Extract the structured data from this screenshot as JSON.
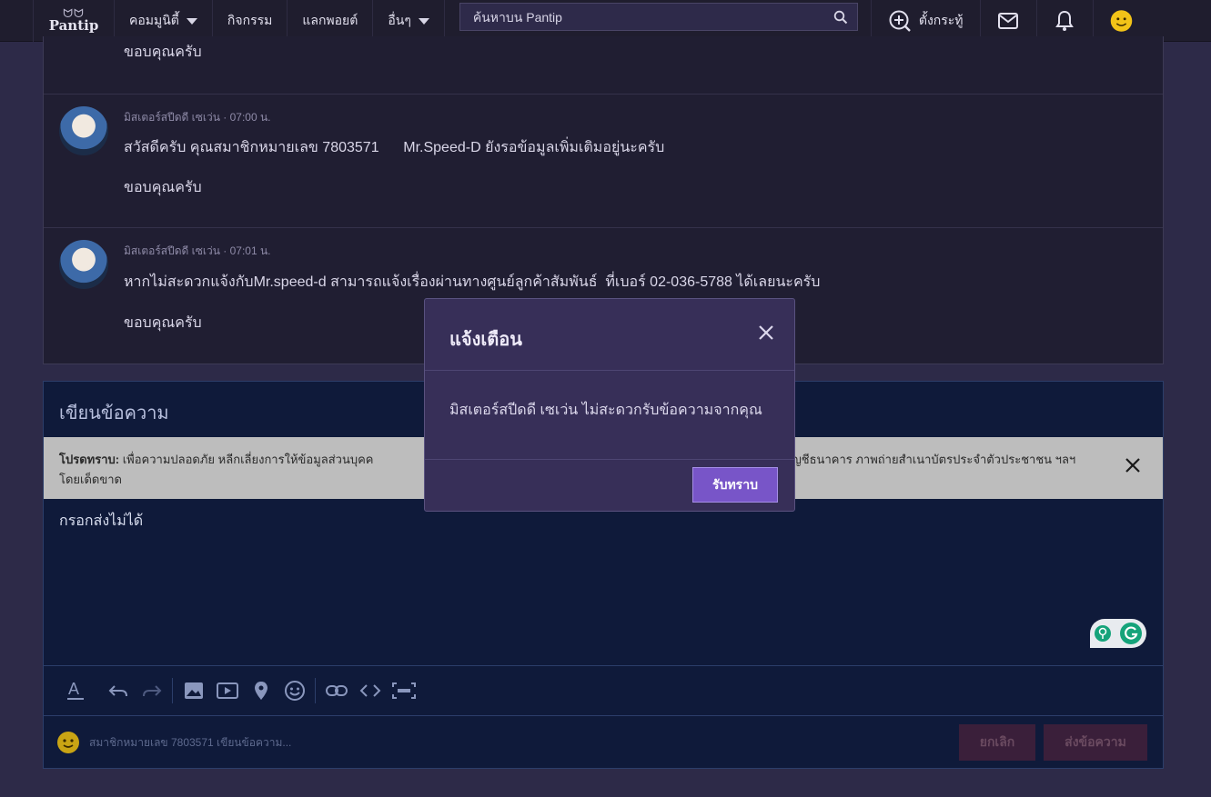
{
  "header": {
    "logo_mark": "ᗢᗢ",
    "logo_text": "Pantip",
    "nav": [
      "คอมมูนิตี้",
      "กิจกรรม",
      "แลกพอยต์",
      "อื่นๆ"
    ],
    "search_placeholder": "ค้นหาบน Pantip",
    "new_topic_label": "ตั้งกระทู้"
  },
  "thread": {
    "top_text": "ขอบคุณครับ",
    "replies": [
      {
        "author": "มิสเตอร์สปีดดี เซเว่น",
        "time": "07:00 น.",
        "message": "สวัสดีครับ คุณสมาชิกหมายเลข 7803571      Mr.Speed-D ยังรอข้อมูลเพิ่มเติมอยู่นะครับ",
        "closing": "ขอบคุณครับ"
      },
      {
        "author": "มิสเตอร์สปีดดี เซเว่น",
        "time": "07:01 น.",
        "message": "หากไม่สะดวกแจ้งกับMr.speed-d สามารถแจ้งเรื่องผ่านทางศูนย์ลูกค้าสัมพันธ์  ที่เบอร์ 02-036-5788 ได้เลยนะครับ",
        "closing": "ขอบคุณครับ"
      }
    ]
  },
  "composer": {
    "title": "เขียนข้อความ",
    "notice_label": "โปรดทราบ:",
    "notice_text": " เพื่อความปลอดภัย หลีกเลี่ยงการให้ข้อมูลส่วนบุคค",
    "notice_text_tail": "ที่อยู่ หมายเลขบัญชีธนาคาร ภาพถ่ายสำเนาบัตรประจำตัวประชาชน ฯลฯ โดยเด็ดขาด",
    "editor_text": "กรอกส่งไม่ได้",
    "author_line": "สมาชิกหมายเลข 7803571 เขียนข้อความ...",
    "cancel_label": "ยกเลิก",
    "send_label": "ส่งข้อความ"
  },
  "modal": {
    "title": "แจ้งเตือน",
    "body": "มิสเตอร์สปีดดี เซเว่น ไม่สะดวกรับข้อความจากคุณ",
    "ok_label": "รับทราบ"
  },
  "colors": {
    "accent": "#7855c8",
    "background": "#2d2a48",
    "composer_bg": "#0f1a3a"
  }
}
